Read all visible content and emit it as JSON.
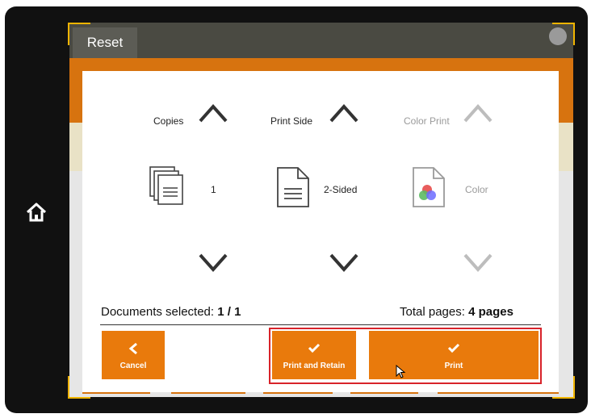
{
  "header": {
    "reset_label": "Reset",
    "settings_icon": "settings-icon"
  },
  "side": {
    "home_icon": "home-icon"
  },
  "copies": {
    "label": "Copies",
    "value": "1",
    "icon": "copies-icon"
  },
  "print_side": {
    "label": "Print Side",
    "value": "2-Sided",
    "icon": "document-icon"
  },
  "color_print": {
    "label": "Color Print",
    "value": "Color",
    "icon": "color-document-icon",
    "disabled": true
  },
  "summary": {
    "docs_label": "Documents selected: ",
    "docs_value": "1 / 1",
    "pages_label": "Total pages: ",
    "pages_value": "4 pages"
  },
  "buttons": {
    "cancel": "Cancel",
    "print_retain": "Print and Retain",
    "print": "Print"
  },
  "colors": {
    "accent": "#e97a0c",
    "highlight": "#d8232a",
    "topbar": "#4a4a42"
  }
}
